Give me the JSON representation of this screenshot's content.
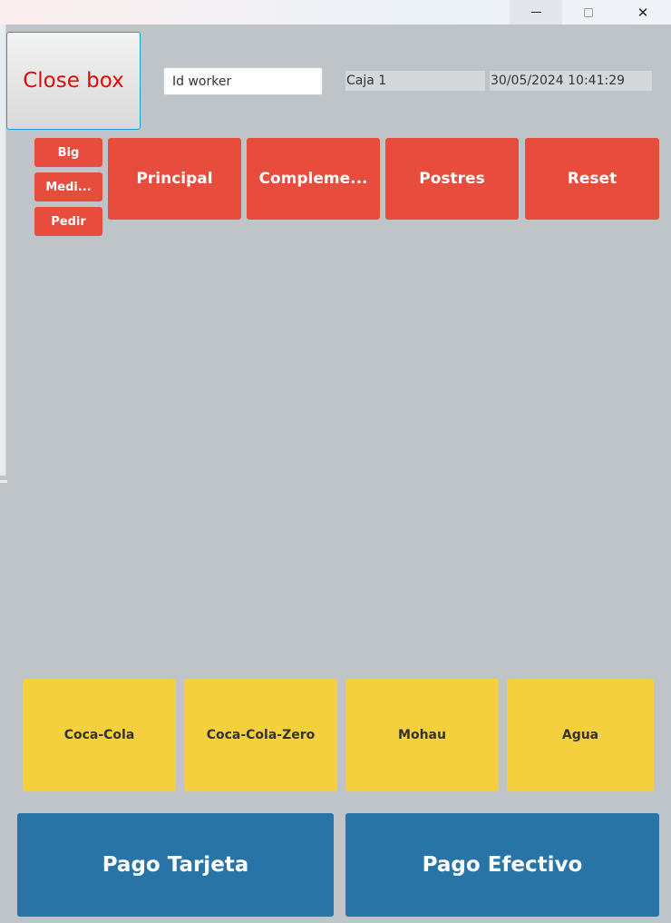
{
  "window": {
    "minimize_icon": "minimize-icon",
    "maximize_icon": "maximize-icon",
    "close_glyph": "✕"
  },
  "header": {
    "close_box_label": "Close box",
    "id_worker_placeholder": "Id worker",
    "caja": "Caja 1",
    "datetime": "30/05/2024 10:41:29"
  },
  "size_buttons": [
    {
      "label": "Big"
    },
    {
      "label": "Medi..."
    },
    {
      "label": "Pedir"
    }
  ],
  "categories": [
    {
      "label": "Principal"
    },
    {
      "label": "Compleme..."
    },
    {
      "label": "Postres"
    },
    {
      "label": "Reset"
    }
  ],
  "drinks": [
    {
      "label": "Coca-Cola"
    },
    {
      "label": "Coca-Cola-Zero"
    },
    {
      "label": "Mohau"
    },
    {
      "label": "Agua"
    }
  ],
  "payment": {
    "card_label": "Pago Tarjeta",
    "cash_label": "Pago Efectivo"
  },
  "colors": {
    "background": "#bfc4c8",
    "red": "#e74c3c",
    "yellow": "#f4d03f",
    "blue": "#2874a6",
    "close_text": "#e20b0b"
  }
}
